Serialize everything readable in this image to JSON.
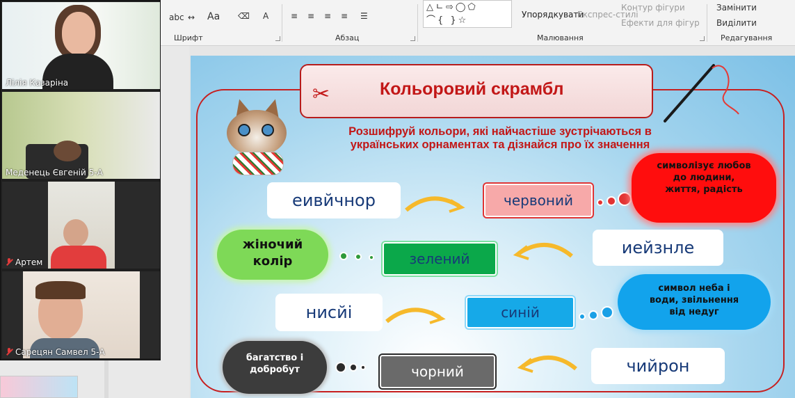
{
  "ribbon": {
    "font_group": "Шрифт",
    "paragraph_group": "Абзац",
    "drawing_group": "Малювання",
    "editing_group": "Редагування",
    "arrange": "Упорядкувати",
    "quick_styles": "Експрес-стилі",
    "shape_outline": "Контур фігури",
    "shape_effects": "Ефекти для фігур",
    "replace": "Замінити",
    "select": "Виділити",
    "font_size_label": "Aa"
  },
  "participants": [
    {
      "name": "Лілія Казаріна",
      "muted": false
    },
    {
      "name": "Меденець Євгеній 5-А",
      "muted": false
    },
    {
      "name": "Артем",
      "muted": true
    },
    {
      "name": "Сарецян Самвел 5-А",
      "muted": true
    }
  ],
  "slide": {
    "title": "Кольоровий скрамбл",
    "instruction": "Розшифруй кольори, які найчастіше зустрічаються в українських орнаментах та дізнайся про їх значення",
    "rows": [
      {
        "scrambled": "еивйчнор",
        "answer": "червоний",
        "meaning": "символізує любов до людини, життя, радість"
      },
      {
        "scrambled": "иейзнле",
        "answer": "зелений",
        "meaning": "жіночий колір"
      },
      {
        "scrambled": "нисйі",
        "answer": "синій",
        "meaning": "символ неба і води, звільнення від недуг"
      },
      {
        "scrambled": "чийрон",
        "answer": "чорний",
        "meaning": "багатство і добробут"
      }
    ]
  },
  "colors": {
    "title_red": "#c21717",
    "answer_red_fill": "#f7a9a9",
    "answer_green_fill": "#0ba84a",
    "answer_blue_fill": "#16a9e8",
    "answer_black_fill": "#6a6a6a"
  }
}
